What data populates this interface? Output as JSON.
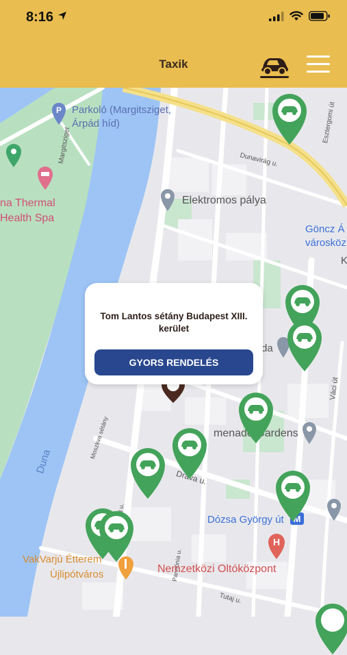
{
  "status_bar": {
    "time": "8:16"
  },
  "header": {
    "title": "Taxik"
  },
  "map": {
    "labels": {
      "parking": "Parkoló (Margitsziget,",
      "parking2": "Árpád híd)",
      "margitsziget": "Margitsziget",
      "thermal": "na Thermal",
      "health_spa": "Health Spa",
      "elektromos": "Elektromos pálya",
      "duna": "Duna",
      "dunavirag": "Dunavirág u.",
      "esztergomi": "Esztergomi út",
      "goncz": "Göncz Á",
      "varoskozp": "városköz",
      "k_letter": "K",
      "da": "da",
      "promenade": "menade Gardens",
      "vaci": "Váci út",
      "drava": "Dráva u.",
      "dozsa": "Dózsa György út",
      "moszkva": "Moszkva sétány",
      "arpad_u": "Árpád u.",
      "pannonia": "Pannónia u.",
      "vakvarju1": "VakVarjú Étterem",
      "vakvarju2": "Újlipótváros",
      "nemzetkozi": "Nemzetközi Oltóközpont",
      "tutaj": "Tutaj u.",
      "metro": "M"
    }
  },
  "popup": {
    "address": "Tom Lantos sétány  Budapest XIII. kerület",
    "button_label": "GYORS RENDELÉS"
  },
  "colors": {
    "header_bg": "#e9bd4f",
    "pin_green": "#43a35a",
    "button_blue": "#28478e",
    "river": "#9dc4f5",
    "park": "#b8e0c0"
  },
  "taxi_count": 11
}
